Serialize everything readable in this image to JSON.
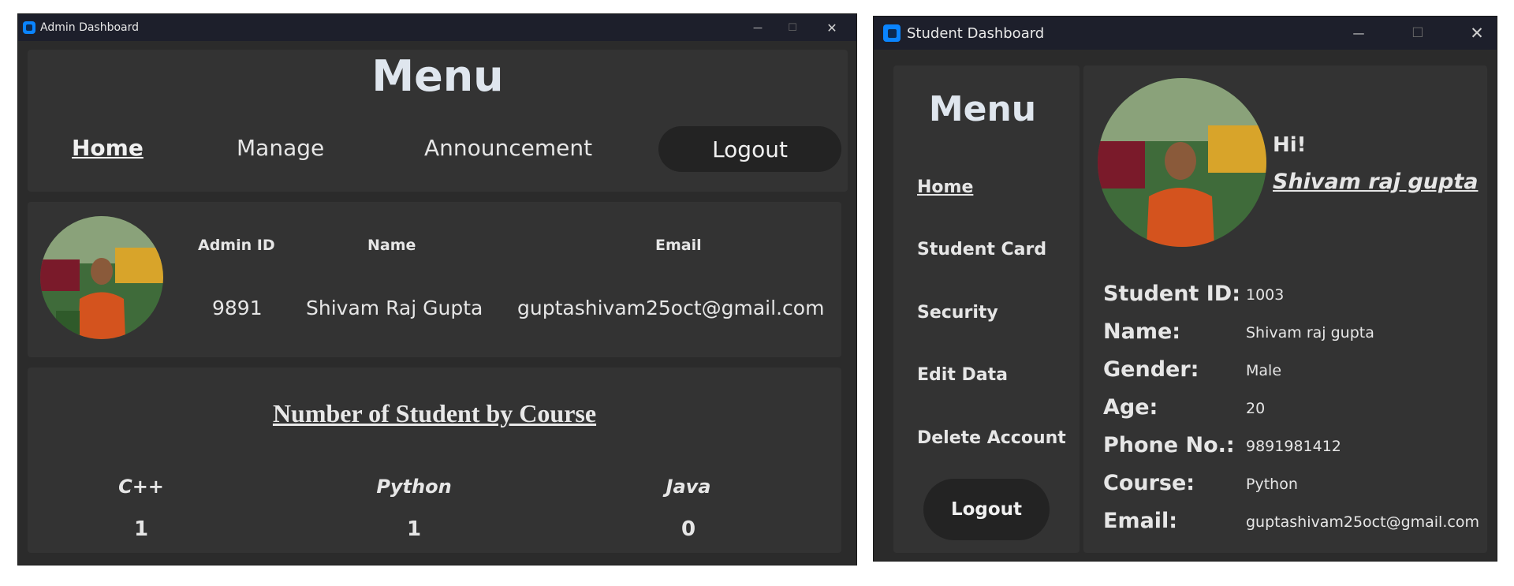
{
  "admin": {
    "window_title": "Admin Dashboard",
    "menu_title": "Menu",
    "nav": [
      {
        "label": "Home"
      },
      {
        "label": "Manage"
      },
      {
        "label": "Announcement"
      }
    ],
    "logout_label": "Logout",
    "profile": {
      "headers": [
        "Admin ID",
        "Name",
        "Email"
      ],
      "values": [
        "9891",
        "Shivam Raj Gupta",
        "guptashivam25oct@gmail.com"
      ]
    },
    "course_title": "Number of Student by Course",
    "courses": [
      {
        "name": "C++",
        "count": "1"
      },
      {
        "name": "Python",
        "count": "1"
      },
      {
        "name": "Java",
        "count": "0"
      }
    ]
  },
  "student": {
    "window_title": "Student Dashboard",
    "menu_title": "Menu",
    "sidebar": [
      {
        "label": "Home"
      },
      {
        "label": "Student Card"
      },
      {
        "label": "Security"
      },
      {
        "label": "Edit Data"
      },
      {
        "label": "Delete Account"
      }
    ],
    "logout_label": "Logout",
    "greeting": "Hi!",
    "user_name": "Shivam raj gupta",
    "details": [
      {
        "label": "Student ID:",
        "value": "1003"
      },
      {
        "label": "Name:",
        "value": "Shivam raj gupta"
      },
      {
        "label": "Gender:",
        "value": "Male"
      },
      {
        "label": "Age:",
        "value": "20"
      },
      {
        "label": "Phone No.:",
        "value": "9891981412"
      },
      {
        "label": "Course:",
        "value": "Python"
      },
      {
        "label": "Email:",
        "value": "guptashivam25oct@gmail.com"
      }
    ]
  },
  "window_controls": {
    "minimize": "—",
    "maximize": "☐",
    "close": "✕"
  },
  "colors": {
    "accent": "#0a84ff",
    "window_bg": "#2b2b2b",
    "panel_bg": "#333333",
    "button_bg": "#232323"
  }
}
